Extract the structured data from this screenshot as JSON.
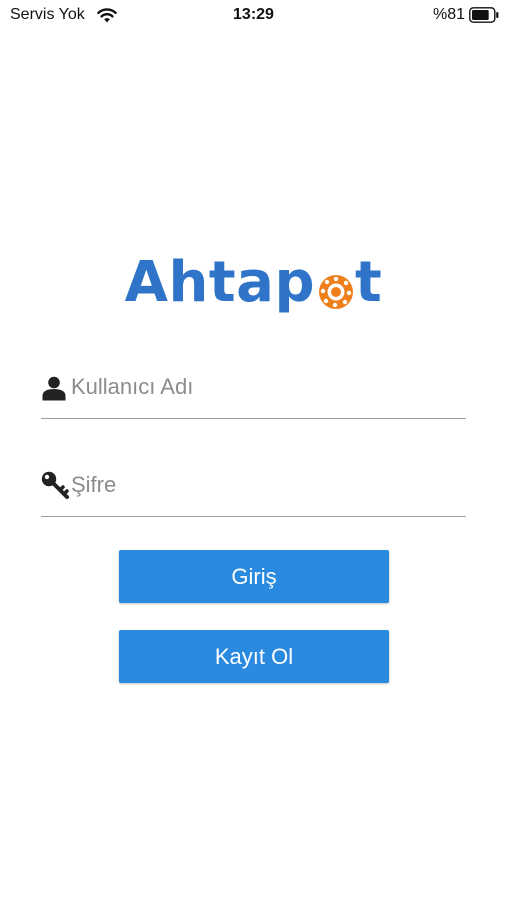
{
  "status_bar": {
    "carrier": "Servis Yok",
    "time": "13:29",
    "battery_percent": "%81",
    "battery_level": 0.81
  },
  "logo": {
    "text_before": "Ahtap",
    "text_after": "t",
    "brand_color": "#2f74c8",
    "accent_color": "#ef7f1a"
  },
  "form": {
    "username": {
      "placeholder": "Kullanıcı Adı",
      "value": "",
      "icon": "user-icon"
    },
    "password": {
      "placeholder": "Şifre",
      "value": "",
      "icon": "key-icon"
    }
  },
  "buttons": {
    "login_label": "Giriş",
    "register_label": "Kayıt Ol",
    "color": "#2a8adf"
  }
}
